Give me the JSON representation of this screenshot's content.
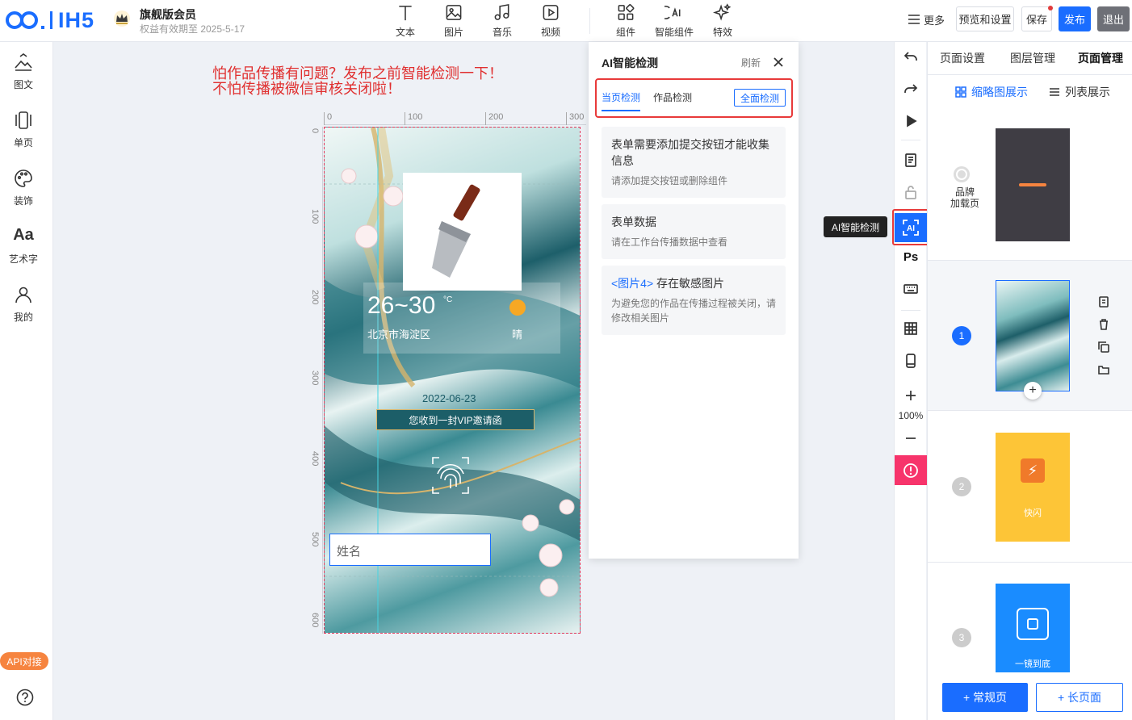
{
  "header": {
    "logo_text": "IH5",
    "member_title": "旗舰版会员",
    "member_expiry": "权益有效期至 2025-5-17",
    "tools": [
      {
        "label": "文本",
        "icon": "text-icon"
      },
      {
        "label": "图片",
        "icon": "image-icon"
      },
      {
        "label": "音乐",
        "icon": "music-icon"
      },
      {
        "label": "视频",
        "icon": "video-icon"
      },
      {
        "label": "组件",
        "icon": "component-icon"
      },
      {
        "label": "智能组件",
        "icon": "ai-component-icon"
      },
      {
        "label": "特效",
        "icon": "sparkle-icon"
      }
    ],
    "more": "更多",
    "preview": "预览和设置",
    "save": "保存",
    "publish": "发布",
    "exit": "退出"
  },
  "sidebar": {
    "items": [
      {
        "label": "图文",
        "icon": "image-text-icon"
      },
      {
        "label": "单页",
        "icon": "single-page-icon"
      },
      {
        "label": "装饰",
        "icon": "palette-icon"
      },
      {
        "label": "艺术字",
        "icon": "art-text-icon"
      },
      {
        "label": "我的",
        "icon": "user-icon"
      }
    ],
    "api_label": "API对接",
    "help_icon": "help-icon"
  },
  "annotation": {
    "line1": "怕作品传播有问题？发布之前智能检测一下！",
    "line2": "不怕传播被微信审核关闭啦！"
  },
  "ruler": {
    "top": [
      "0",
      "100",
      "200",
      "300"
    ],
    "left": [
      "0",
      "100",
      "200",
      "300",
      "400",
      "500",
      "600"
    ]
  },
  "phone": {
    "temp": "26~30",
    "temp_unit": "°C",
    "city": "北京市海淀区",
    "weather": "晴",
    "date": "2022-06-23",
    "invite": "您收到一封VIP邀请函",
    "name_placeholder": "姓名"
  },
  "ai_panel": {
    "title": "AI智能检测",
    "refresh": "刷新",
    "tabs": [
      "当页检测",
      "作品检测"
    ],
    "full_check": "全面检测",
    "cards": [
      {
        "title": "表单需要添加提交按钮才能收集信息",
        "desc": "请添加提交按钮或删除组件"
      },
      {
        "title": "表单数据",
        "desc": "请在工作台传播数据中查看"
      },
      {
        "link": "<图片4>",
        "title": " 存在敏感图片",
        "desc": "为避免您的作品在传播过程被关闭，请修改相关图片"
      }
    ]
  },
  "right_tools": {
    "tooltip": "AI智能检测",
    "zoom": "100%"
  },
  "right_panel": {
    "tabs": [
      "页面设置",
      "图层管理",
      "页面管理"
    ],
    "view_thumb": "缩略图展示",
    "view_list": "列表展示",
    "loading_label_1": "品牌",
    "loading_label_2": "加载页",
    "pages": [
      {
        "num": "1",
        "caption": ""
      },
      {
        "num": "2",
        "caption": "快闪"
      },
      {
        "num": "3",
        "caption": "一镜到底"
      }
    ],
    "add_normal": "+ 常规页",
    "add_long": "+ 长页面"
  },
  "colors": {
    "accent": "#1a6dff",
    "danger": "#e23b3b",
    "pink": "#f7346b",
    "api": "#f6843f"
  }
}
